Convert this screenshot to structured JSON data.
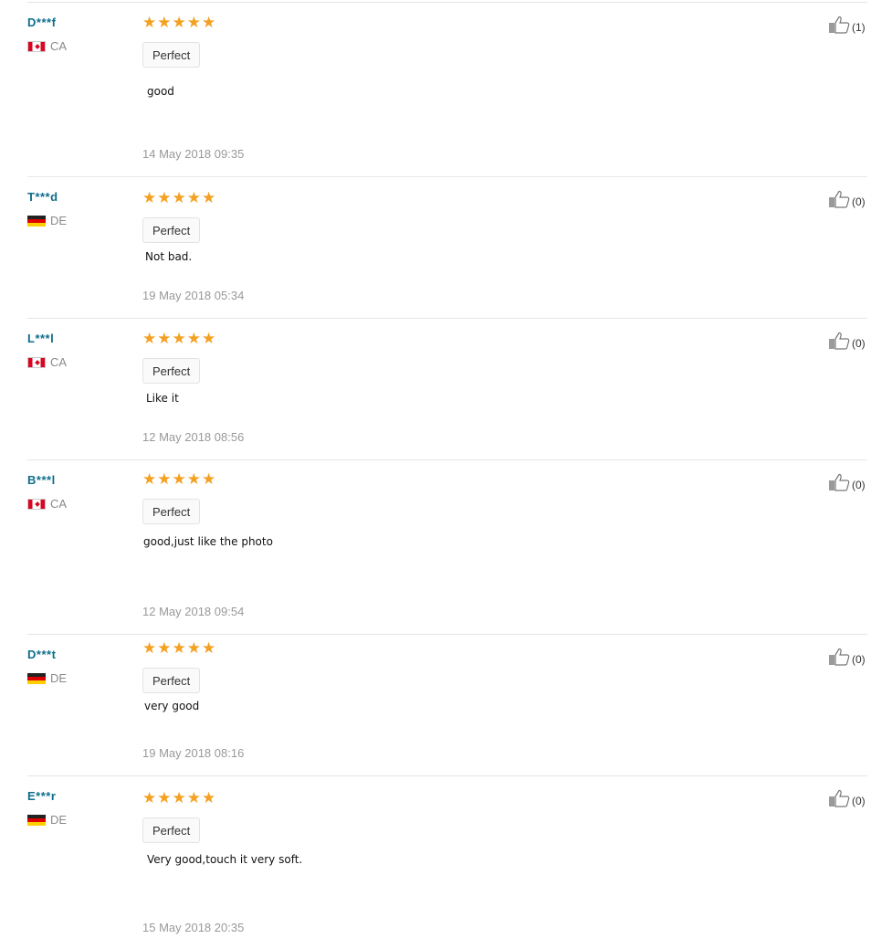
{
  "reviews": [
    {
      "user": "D***f",
      "country": "CA",
      "flag": "canada-flag-icon",
      "rating": 5,
      "tag": "Perfect",
      "text": "good",
      "date": "14 May 2018 09:35",
      "helpful": "(1)"
    },
    {
      "user": "T***d",
      "country": "DE",
      "flag": "germany-flag-icon",
      "rating": 5,
      "tag": "Perfect",
      "text": "Not bad.",
      "date": "19 May 2018 05:34",
      "helpful": "(0)"
    },
    {
      "user": "L***l",
      "country": "CA",
      "flag": "canada-flag-icon",
      "rating": 5,
      "tag": "Perfect",
      "text": "Like it",
      "date": "12 May 2018 08:56",
      "helpful": "(0)"
    },
    {
      "user": "B***l",
      "country": "CA",
      "flag": "canada-flag-icon",
      "rating": 5,
      "tag": "Perfect",
      "text": "good,just like the photo",
      "date": "12 May 2018 09:54",
      "helpful": "(0)"
    },
    {
      "user": "D***t",
      "country": "DE",
      "flag": "germany-flag-icon",
      "rating": 5,
      "tag": "Perfect",
      "text": "very good",
      "date": "19 May 2018 08:16",
      "helpful": "(0)"
    },
    {
      "user": "E***r",
      "country": "DE",
      "flag": "germany-flag-icon",
      "rating": 5,
      "tag": "Perfect",
      "text": "Very good,touch it very soft.",
      "date": "15 May 2018 20:35",
      "helpful": "(0)"
    }
  ],
  "icons": {
    "star": "star-icon",
    "helpful": "thumbs-up-icon"
  },
  "colors": {
    "username": "#0e6e8c",
    "star": "#f4a021",
    "date": "#999999"
  }
}
